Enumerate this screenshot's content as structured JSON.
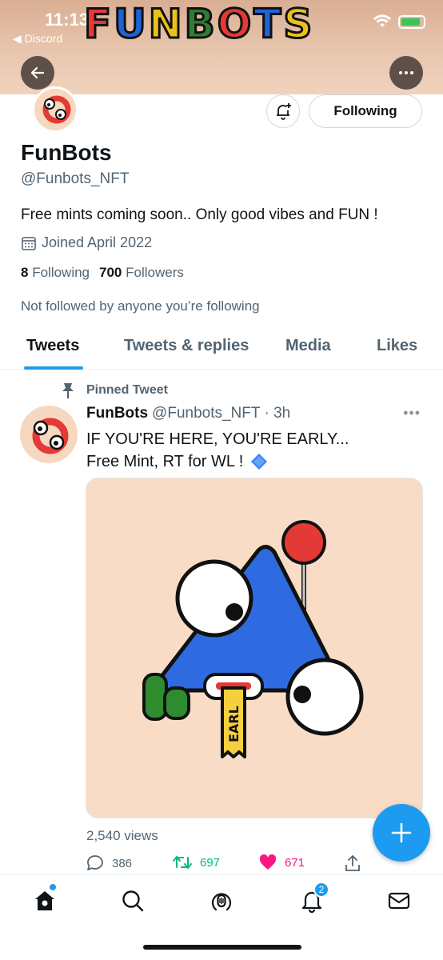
{
  "status_bar": {
    "time": "11:13",
    "back_app": "◀ Discord"
  },
  "banner": {
    "logo_letters": [
      "F",
      "U",
      "N",
      "B",
      "O",
      "T",
      "S"
    ],
    "logo_colors": [
      "#e53935",
      "#1e63d8",
      "#e8c21a",
      "#2e7d32",
      "#e53935",
      "#1e63d8",
      "#e8c21a"
    ]
  },
  "header": {
    "back_icon": "arrow-left-icon",
    "more_icon": "more-horizontal-icon"
  },
  "profile": {
    "name": "FunBots",
    "handle": "@Funbots_NFT",
    "bio": "Free mints coming soon.. Only good vibes and FUN !",
    "joined": "Joined April 2022",
    "following_count": "8",
    "following_label": "Following",
    "followers_count": "700",
    "followers_label": "Followers",
    "followed_note": "Not followed by anyone you’re following",
    "follow_button": "Following"
  },
  "tabs": [
    {
      "label": "Tweets",
      "active": true
    },
    {
      "label": "Tweets & replies",
      "active": false
    },
    {
      "label": "Media",
      "active": false
    },
    {
      "label": "Likes",
      "active": false
    }
  ],
  "tweet": {
    "pinned_label": "Pinned Tweet",
    "author_name": "FunBots",
    "author_handle": "@Funbots_NFT",
    "time": "· 3h",
    "text_line1": "IF YOU'RE HERE, YOU'RE EARLY...",
    "text_line2": "Free Mint, RT for WL !",
    "media_ticket_text": "EARL",
    "views": "2,540 views",
    "replies": "386",
    "retweets": "697",
    "likes": "671"
  },
  "bottom_nav": {
    "notifications_badge": "2"
  },
  "colors": {
    "accent": "#1d9bf0",
    "retweet": "#00ba7c",
    "like": "#f91880",
    "secondary_text": "#536471"
  }
}
